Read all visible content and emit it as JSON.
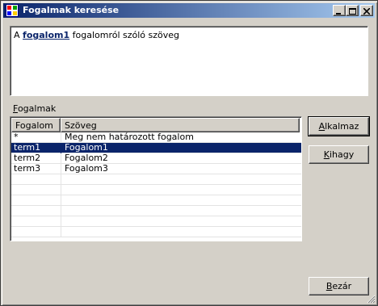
{
  "window": {
    "title": "Fogalmak keresése"
  },
  "titlebar_buttons": {
    "minimize": "_",
    "maximize": "□",
    "close": "×"
  },
  "description": {
    "prefix": "A ",
    "term": "fogalom1",
    "suffix": " fogalomról szóló szöveg"
  },
  "group": {
    "label_first": "F",
    "label_rest": "ogalmak"
  },
  "table": {
    "columns": [
      "Fogalom",
      "Szöveg"
    ],
    "rows": [
      {
        "term": "*",
        "text": "Meg nem határozott fogalom",
        "selected": false
      },
      {
        "term": "term1",
        "text": "Fogalom1",
        "selected": true
      },
      {
        "term": "term2",
        "text": "Fogalom2",
        "selected": false
      },
      {
        "term": "term3",
        "text": "Fogalom3",
        "selected": false
      },
      {
        "term": "",
        "text": "",
        "selected": false
      },
      {
        "term": "",
        "text": "",
        "selected": false
      },
      {
        "term": "",
        "text": "",
        "selected": false
      },
      {
        "term": "",
        "text": "",
        "selected": false
      },
      {
        "term": "",
        "text": "",
        "selected": false
      },
      {
        "term": "",
        "text": "",
        "selected": false
      }
    ]
  },
  "buttons": {
    "apply": {
      "first": "A",
      "rest": "lkalmaz"
    },
    "skip": {
      "first": "K",
      "rest": "ihagy"
    },
    "close": {
      "first": "B",
      "rest": "ezár"
    }
  },
  "colors": {
    "title_gradient_start": "#0a246a",
    "title_gradient_end": "#a6caf0",
    "selection": "#0a246a",
    "face": "#d4d0c8"
  }
}
